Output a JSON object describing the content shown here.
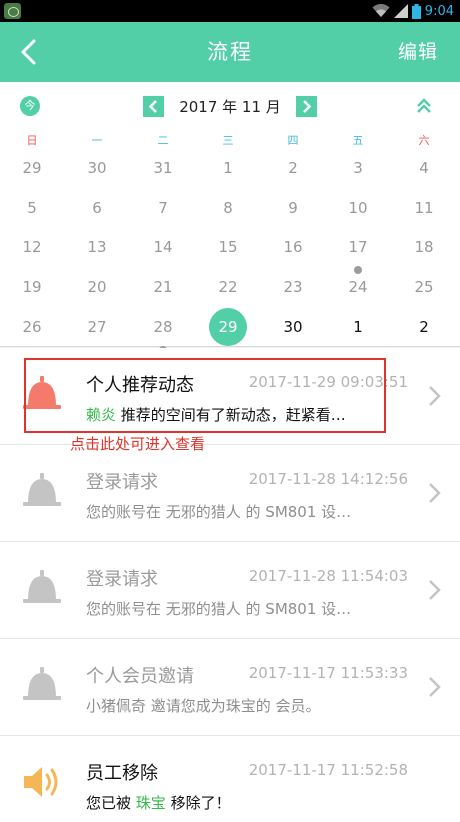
{
  "status_bar": {
    "time": "9:04"
  },
  "header": {
    "title": "流程",
    "edit_label": "编辑"
  },
  "calendar": {
    "today_label": "今",
    "month_label": "2017 年 11 月",
    "weekdays": [
      "日",
      "一",
      "二",
      "三",
      "四",
      "五",
      "六"
    ],
    "weeks": [
      [
        "29",
        "30",
        "31",
        "1",
        "2",
        "3",
        "4"
      ],
      [
        "5",
        "6",
        "7",
        "8",
        "9",
        "10",
        "11"
      ],
      [
        "12",
        "13",
        "14",
        "15",
        "16",
        "17",
        "18"
      ],
      [
        "19",
        "20",
        "21",
        "22",
        "23",
        "24",
        "25"
      ],
      [
        "26",
        "27",
        "28",
        "29",
        "30",
        "1",
        "2"
      ]
    ]
  },
  "hint": "点击此处可进入查看",
  "list": [
    {
      "title": "个人推荐动态",
      "time": "2017-11-29 09:03:51",
      "desc_name": "赖炎",
      "desc": " 推荐的空间有了新动态，赶紧看…",
      "icon": "bell-icon"
    },
    {
      "title": "登录请求",
      "time": "2017-11-28 14:12:56",
      "desc": "您的账号在 无邪的猎人 的 SM801 设…",
      "icon": "bell-icon"
    },
    {
      "title": "登录请求",
      "time": "2017-11-28 11:54:03",
      "desc": "您的账号在 无邪的猎人 的 SM801 设…",
      "icon": "bell-icon"
    },
    {
      "title": "个人会员邀请",
      "time": "2017-11-17 11:53:33",
      "desc": "小猪佩奇 邀请您成为珠宝的 会员。",
      "icon": "bell-icon"
    },
    {
      "title": "员工移除",
      "time": "2017-11-17 11:52:58",
      "desc_a": "您已被 ",
      "desc_name": "珠宝",
      "desc_b": " 移除了！",
      "icon": "speaker-icon"
    }
  ]
}
